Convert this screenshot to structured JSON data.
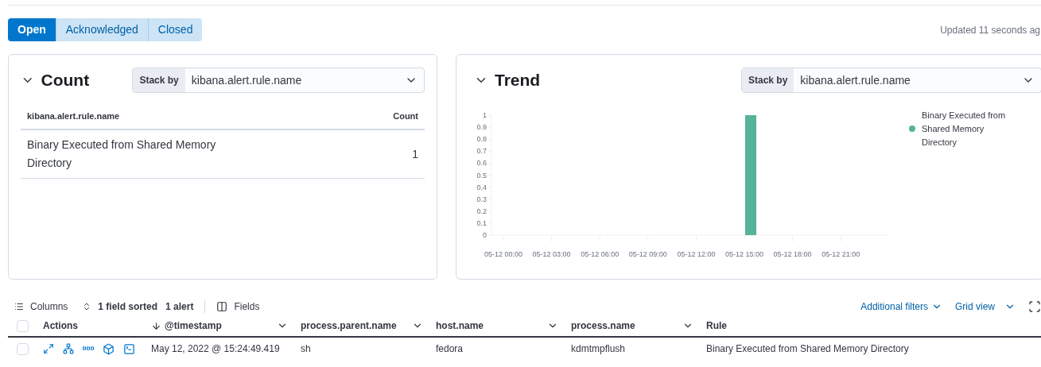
{
  "status_tabs": [
    {
      "label": "Open",
      "selected": true
    },
    {
      "label": "Acknowledged",
      "selected": false
    },
    {
      "label": "Closed",
      "selected": false
    }
  ],
  "updated": "Updated 11 seconds ag",
  "count_panel": {
    "title": "Count",
    "expanded": true,
    "stack_by": {
      "label": "Stack by",
      "value": "kibana.alert.rule.name"
    },
    "columns": [
      "kibana.alert.rule.name",
      "Count"
    ],
    "rows": [
      {
        "name": "Binary Executed from Shared Memory Directory",
        "count": "1"
      }
    ]
  },
  "trend_panel": {
    "title": "Trend",
    "expanded": true,
    "stack_by": {
      "label": "Stack by",
      "value": "kibana.alert.rule.name"
    },
    "chart_data": {
      "type": "bar",
      "categories": [
        "05-12 00:00",
        "05-12 03:00",
        "05-12 06:00",
        "05-12 09:00",
        "05-12 12:00",
        "05-12 15:00",
        "05-12 18:00",
        "05-12 21:00"
      ],
      "series": [
        {
          "name": "Binary Executed from Shared Memory Directory",
          "color": "#54b399",
          "values": [
            0,
            0,
            0,
            0,
            0,
            1,
            0,
            0
          ]
        }
      ],
      "ylim": [
        0,
        1
      ],
      "yticks": [
        0,
        0.1,
        0.2,
        0.3,
        0.4,
        0.5,
        0.6,
        0.7,
        0.8,
        0.9,
        1
      ]
    }
  },
  "toolbar": {
    "columns": "Columns",
    "sorted": "1 field sorted",
    "count": "1 alert",
    "fields": "Fields",
    "additional_filters": "Additional filters",
    "grid_view": "Grid view"
  },
  "table": {
    "all_checked": false,
    "columns": [
      {
        "label": "Actions",
        "sorted": false,
        "menu": false
      },
      {
        "label": "@timestamp",
        "sorted": true,
        "menu": true
      },
      {
        "label": "process.parent.name",
        "sorted": false,
        "menu": true
      },
      {
        "label": "host.name",
        "sorted": false,
        "menu": true
      },
      {
        "label": "process.name",
        "sorted": false,
        "menu": true
      },
      {
        "label": "Rule",
        "sorted": false,
        "menu": false
      }
    ],
    "rows": [
      {
        "checked": false,
        "cells": [
          "",
          "May 12, 2022 @ 15:24:49.419",
          "sh",
          "fedora",
          "kdmtmpflush",
          "Binary Executed from Shared Memory Directory"
        ]
      }
    ]
  }
}
